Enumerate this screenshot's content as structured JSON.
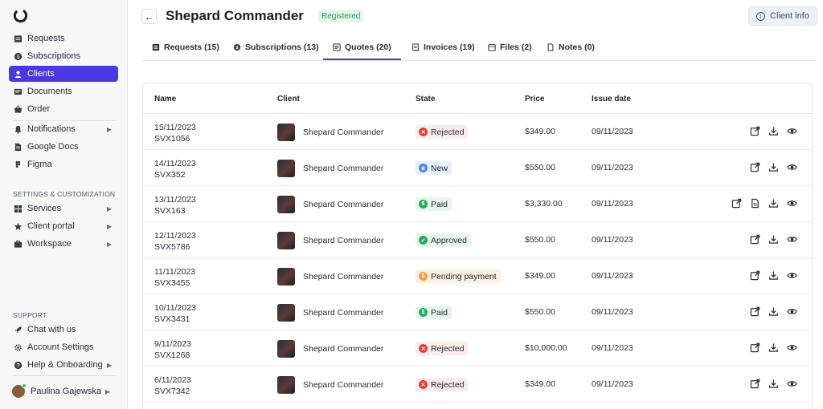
{
  "sidebar": {
    "primary": [
      {
        "label": "Requests",
        "icon": "requests-icon"
      },
      {
        "label": "Subscriptions",
        "icon": "subscriptions-icon"
      },
      {
        "label": "Clients",
        "icon": "clients-icon"
      },
      {
        "label": "Documents",
        "icon": "documents-icon"
      },
      {
        "label": "Order",
        "icon": "order-icon"
      }
    ],
    "secondary": [
      {
        "label": "Notifications",
        "icon": "bell-icon"
      },
      {
        "label": "Google Docs",
        "icon": "google-docs-icon"
      },
      {
        "label": "Figma",
        "icon": "figma-icon"
      }
    ],
    "settings_label": "SETTINGS & CUSTOMIZATION",
    "settings": [
      {
        "label": "Services",
        "icon": "services-icon"
      },
      {
        "label": "Client portal",
        "icon": "star-icon"
      },
      {
        "label": "Workspace",
        "icon": "workspace-icon"
      }
    ],
    "support_label": "SUPPORT",
    "support": [
      {
        "label": "Chat with us",
        "icon": "rocket-icon"
      },
      {
        "label": "Account Settings",
        "icon": "gear-icon"
      },
      {
        "label": "Help & Onboarding",
        "icon": "help-icon"
      }
    ],
    "user": {
      "name": "Paulina Gajewska"
    },
    "active_color": "#4a38e0"
  },
  "header": {
    "title": "Shepard Commander",
    "status": "Registered",
    "client_info_label": "Client info"
  },
  "tabs": [
    {
      "label": "Requests (15)",
      "icon": "list-icon"
    },
    {
      "label": "Subscriptions (13)",
      "icon": "subscriptions-icon"
    },
    {
      "label": "Quotes (20)",
      "icon": "quote-icon"
    },
    {
      "label": "Invoices (19)",
      "icon": "invoice-icon"
    },
    {
      "label": "Files (2)",
      "icon": "folder-icon"
    },
    {
      "label": "Notes (0)",
      "icon": "note-icon"
    }
  ],
  "table": {
    "headers": {
      "name": "Name",
      "client": "Client",
      "state": "State",
      "price": "Price",
      "issue_date": "Issue date"
    },
    "rows": [
      {
        "date_name": "15/11/2023",
        "code": "SVX1056",
        "client": "Shepard Commander",
        "state": "Rejected",
        "price": "$349.00",
        "issue_date": "09/11/2023",
        "extra_action": false
      },
      {
        "date_name": "14/11/2023",
        "code": "SVX352",
        "client": "Shepard Commander",
        "state": "New",
        "price": "$550.00",
        "issue_date": "09/11/2023",
        "extra_action": false
      },
      {
        "date_name": "13/11/2023",
        "code": "SVX163",
        "client": "Shepard Commander",
        "state": "Paid",
        "price": "$3,330.00",
        "issue_date": "09/11/2023",
        "extra_action": true
      },
      {
        "date_name": "12/11/2023",
        "code": "SVX5786",
        "client": "Shepard Commander",
        "state": "Approved",
        "price": "$550.00",
        "issue_date": "09/11/2023",
        "extra_action": false
      },
      {
        "date_name": "11/11/2023",
        "code": "SVX3455",
        "client": "Shepard Commander",
        "state": "Pending payment",
        "price": "$349.00",
        "issue_date": "09/11/2023",
        "extra_action": false
      },
      {
        "date_name": "10/11/2023",
        "code": "SVX3431",
        "client": "Shepard Commander",
        "state": "Paid",
        "price": "$550.00",
        "issue_date": "09/11/2023",
        "extra_action": false
      },
      {
        "date_name": "9/11/2023",
        "code": "SVX1268",
        "client": "Shepard Commander",
        "state": "Rejected",
        "price": "$10,000.00",
        "issue_date": "09/11/2023",
        "extra_action": false
      },
      {
        "date_name": "6/11/2023",
        "code": "SVX7342",
        "client": "Shepard Commander",
        "state": "Rejected",
        "price": "$349.00",
        "issue_date": "09/11/2023",
        "extra_action": false
      }
    ]
  },
  "state_styles": {
    "Rejected": {
      "bg": "#fdecec",
      "dot": "#e0403a",
      "glyph": "✕"
    },
    "New": {
      "bg": "#e8f0fb",
      "dot": "#4a86d8",
      "glyph": "★"
    },
    "Paid": {
      "bg": "#e6f6ec",
      "dot": "#2aa860",
      "glyph": "$"
    },
    "Approved": {
      "bg": "#e6f6ec",
      "dot": "#2aa860",
      "glyph": "✓"
    },
    "Pending payment": {
      "bg": "#fdf0e3",
      "dot": "#f0a04a",
      "glyph": "$"
    }
  }
}
